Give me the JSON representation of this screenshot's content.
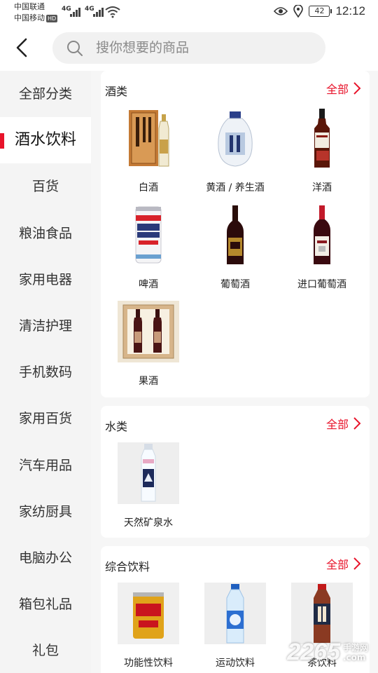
{
  "status_bar": {
    "carrier1": "中国联通",
    "carrier2": "中国移动",
    "hd": "HD",
    "net1": "4G",
    "net2": "4G",
    "battery": "42",
    "time": "12:12"
  },
  "header": {
    "search_placeholder": "搜你想要的商品"
  },
  "sidebar": {
    "items": [
      {
        "label": "全部分类"
      },
      {
        "label": "酒水饮料",
        "active": true
      },
      {
        "label": "百货"
      },
      {
        "label": "粮油食品"
      },
      {
        "label": "家用电器"
      },
      {
        "label": "清洁护理"
      },
      {
        "label": "手机数码"
      },
      {
        "label": "家用百货"
      },
      {
        "label": "汽车用品"
      },
      {
        "label": "家纺厨具"
      },
      {
        "label": "电脑办公"
      },
      {
        "label": "箱包礼品"
      },
      {
        "label": "礼包"
      }
    ]
  },
  "sections": [
    {
      "title": "酒类",
      "all_label": "全部",
      "items": [
        {
          "label": "白酒",
          "icon": "baijiu-box-icon"
        },
        {
          "label": "黄酒 / 养生酒",
          "icon": "huangjiu-jar-icon"
        },
        {
          "label": "洋酒",
          "icon": "whisky-bottle-icon"
        },
        {
          "label": "啤酒",
          "icon": "beer-can-icon"
        },
        {
          "label": "葡萄酒",
          "icon": "wine-bottle-icon"
        },
        {
          "label": "进口葡萄酒",
          "icon": "imported-wine-icon"
        },
        {
          "label": "果酒",
          "icon": "fruit-wine-giftbox-icon"
        }
      ]
    },
    {
      "title": "水类",
      "all_label": "全部",
      "items": [
        {
          "label": "天然矿泉水",
          "icon": "mineral-water-icon"
        }
      ]
    },
    {
      "title": "综合饮料",
      "all_label": "全部",
      "items": [
        {
          "label": "功能性饮料",
          "icon": "energy-drink-can-icon"
        },
        {
          "label": "运动饮料",
          "icon": "sports-drink-bottle-icon"
        },
        {
          "label": "茶饮料",
          "icon": "tea-drink-bottle-icon"
        }
      ]
    }
  ],
  "watermark": {
    "number": "2265",
    "line1": "手游网",
    "line2": ".com"
  },
  "colors": {
    "accent": "#e8132a",
    "sidebar_bg": "#f4f4f4",
    "search_bg": "#f1f1f1"
  }
}
